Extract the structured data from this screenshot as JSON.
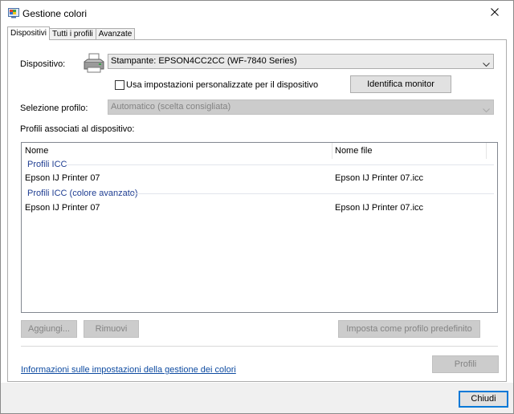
{
  "window": {
    "title": "Gestione colori",
    "close_glyph": "✕"
  },
  "tabs": [
    {
      "label": "Dispositivi",
      "active": true
    },
    {
      "label": "Tutti i profili",
      "active": false
    },
    {
      "label": "Avanzate",
      "active": false
    }
  ],
  "device": {
    "label": "Dispositivo:",
    "selected": "Stampante: EPSON4CC2CC (WF-7840 Series)",
    "icon": "printer-icon"
  },
  "custom_settings": {
    "label": "Usa impostazioni personalizzate per il dispositivo",
    "checked": false
  },
  "identify_button": {
    "label": "Identifica monitor"
  },
  "profile_selection": {
    "label": "Selezione profilo:",
    "selected": "Automatico (scelta consigliata)",
    "disabled": true
  },
  "associated_profiles": {
    "label": "Profili associati al dispositivo:",
    "columns": [
      "Nome",
      "Nome file"
    ],
    "groups": [
      {
        "name": "Profili ICC",
        "rows": [
          {
            "name": "Epson IJ Printer 07",
            "file": "Epson IJ Printer 07.icc"
          }
        ]
      },
      {
        "name": "Profili ICC (colore avanzato)",
        "rows": [
          {
            "name": "Epson IJ Printer 07",
            "file": "Epson IJ Printer 07.icc"
          }
        ]
      }
    ]
  },
  "actions": {
    "add": "Aggiungi...",
    "remove": "Rimuovi",
    "set_default": "Imposta come profilo predefinito"
  },
  "info_link": "Informazioni sulle impostazioni della gestione dei colori",
  "profiles_button": "Profili",
  "close_button": "Chiudi",
  "colors": {
    "link": "#0e4ba1",
    "group_header": "#1e3d92",
    "default_button_border": "#0078d7",
    "disabled_bg": "#cccccc",
    "disabled_text": "#838383"
  }
}
